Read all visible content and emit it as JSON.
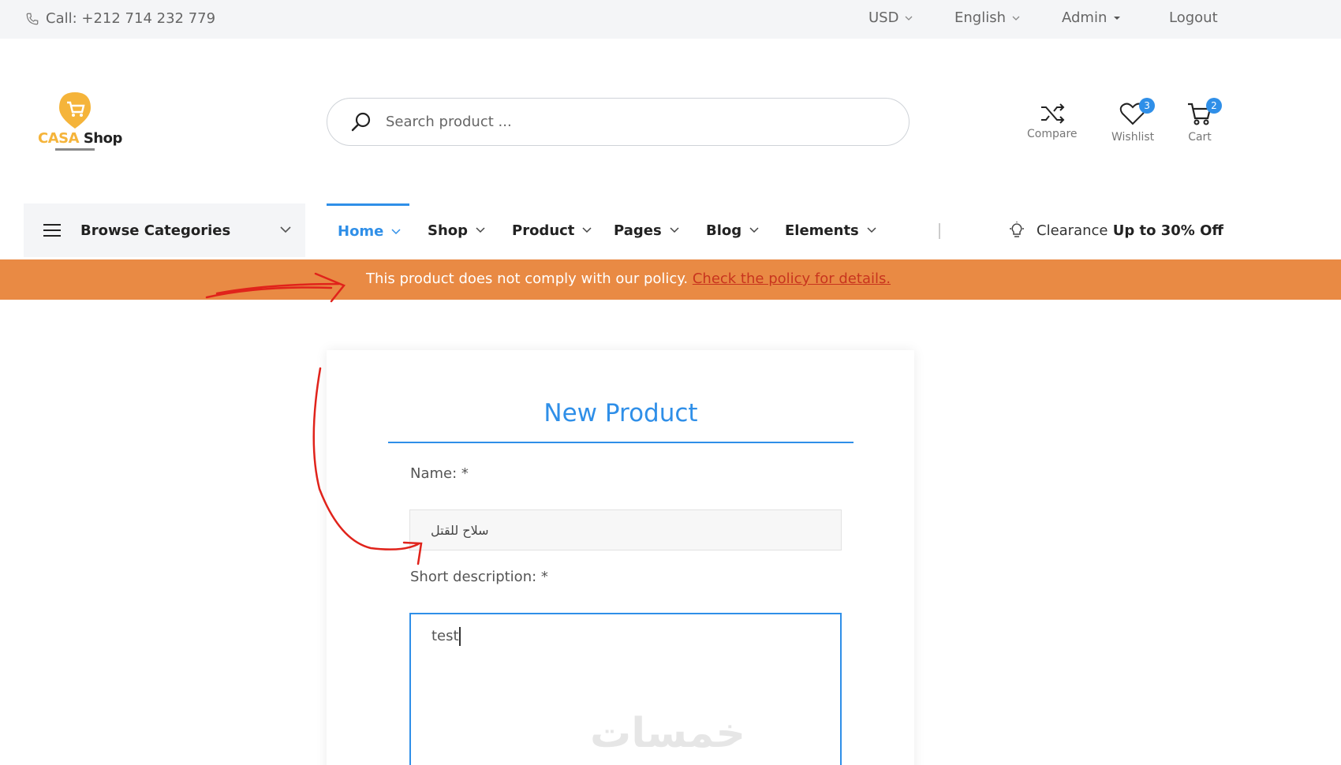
{
  "topbar": {
    "call": "Call: +212 714 232 779",
    "currency": "USD",
    "language": "English",
    "account": "Admin",
    "logout": "Logout"
  },
  "logo": {
    "casa": "CASA",
    "shop": " Shop"
  },
  "search": {
    "placeholder": "Search product ..."
  },
  "header_icons": {
    "compare": {
      "label": "Compare",
      "icon": "shuffle-icon"
    },
    "wishlist": {
      "label": "Wishlist",
      "count": "3",
      "icon": "heart-icon"
    },
    "cart": {
      "label": "Cart",
      "count": "2",
      "icon": "cart-icon"
    }
  },
  "nav": {
    "browse": "Browse Categories",
    "items": [
      {
        "label": "Home",
        "active": true
      },
      {
        "label": "Shop"
      },
      {
        "label": "Product"
      },
      {
        "label": "Pages"
      },
      {
        "label": "Blog"
      },
      {
        "label": "Elements"
      }
    ],
    "clearance_prefix": "Clearance",
    "clearance_bold": " Up to 30% Off"
  },
  "alert": {
    "message": "This product does not comply with our policy. ",
    "link": "Check the policy for details.",
    "color": "#e98a44"
  },
  "form": {
    "title": "New Product",
    "name_label": "Name: *",
    "name_value": "سلاح للقتل",
    "desc_label": "Short description: *",
    "desc_value": "test"
  },
  "watermark": "خمسات",
  "colors": {
    "accent": "#2f8fe8",
    "annotation": "#e0231b"
  }
}
